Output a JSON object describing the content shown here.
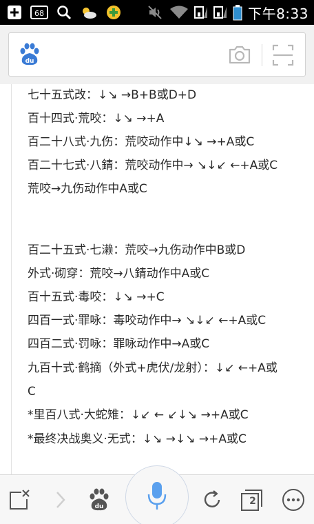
{
  "status_bar": {
    "icons": [
      "add-icon",
      "sixty-eight-badge-icon",
      "search-icon",
      "weather-icon",
      "game-icon",
      "mute-icon",
      "wifi-icon",
      "signal-icon",
      "signal-icon-2",
      "battery-icon"
    ],
    "badge_text": "68",
    "time": "下午8:33"
  },
  "search_bar": {
    "logo_text": "du",
    "icons": [
      "baidu-logo-icon",
      "camera-icon",
      "scan-icon"
    ]
  },
  "content": {
    "lines": [
      "七十五式改：↓↘ →B+B或D+D",
      "百十四式·荒咬：↓↘ →+A",
      "百二十八式·九伤：荒咬动作中↓↘ →+A或C",
      "百二十七式·八錆：荒咬动作中→ ↘↓↙ ←+A或C",
      "荒咬→九伤动作中A或C",
      "百二十五式·七濑：荒咬→九伤动作中B或D",
      "外式·砌穿：荒咬→八錆动作中A或C",
      "百十五式·毒咬：↓↘ →+C",
      "四百一式·罪咏：毒咬动作中→ ↘↓↙ ←+A或C",
      "四百二式·罚咏：罪咏动作中→A或C",
      "九百十式·鹤摘（外式+虎伏/龙射）：↓↙ ←+A或",
      "C",
      "*里百八式·大蛇雉：↓↙ ← ↙↓↘ →+A或C",
      "*最终决战奥义·无式：↓↘ →↓↘ →+A或C"
    ]
  },
  "toolbar": {
    "tabs_count": "2",
    "du_text": "du",
    "icons": [
      "close-window-icon",
      "forward-arrow-icon",
      "baidu-paw-icon",
      "microphone-icon",
      "refresh-icon",
      "tabs-icon",
      "more-icon"
    ]
  },
  "colors": {
    "status_bar_bg": "#000000",
    "header_bg": "#f1f1f1",
    "baidu_blue": "#3a7bd5",
    "mic_blue": "#5aa0ee"
  }
}
